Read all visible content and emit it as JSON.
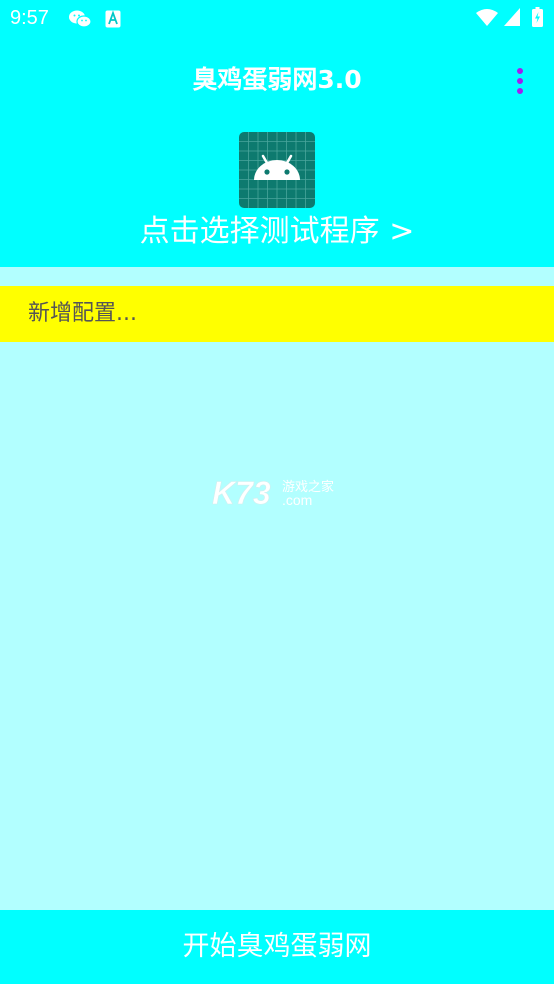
{
  "status_bar": {
    "time": "9:57",
    "icons": [
      "wechat-icon",
      "a-icon",
      "wifi-icon",
      "signal-icon",
      "battery-icon"
    ]
  },
  "toolbar": {
    "title": "臭鸡蛋弱网3.0",
    "menu_icon": "overflow-menu-icon"
  },
  "selector": {
    "icon": "android-icon",
    "label": "点击选择测试程序 >"
  },
  "config_list": {
    "add_label": "新增配置..."
  },
  "watermark": {
    "brand": "K73",
    "tagline": "游戏之家",
    "domain": ".com"
  },
  "footer": {
    "start_label": "开始臭鸡蛋弱网"
  },
  "colors": {
    "header_bg": "#00ffff",
    "body_bg": "#b2ffff",
    "highlight": "#ffff00",
    "menu_dots": "#a020f0",
    "icon_bg": "#0d7a6f"
  }
}
